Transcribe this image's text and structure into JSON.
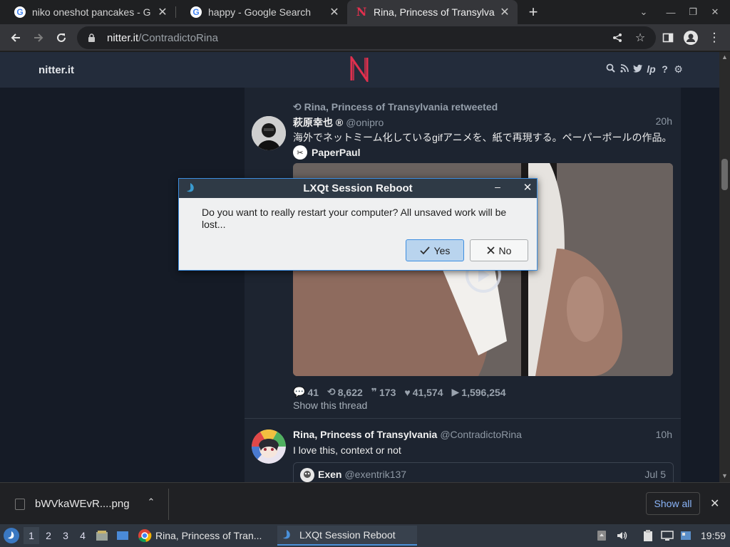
{
  "browser": {
    "tabs": [
      {
        "title": "niko oneshot pancakes - G",
        "favicon": "google-icon"
      },
      {
        "title": "happy - Google Search",
        "favicon": "google-icon"
      },
      {
        "title": "Rina, Princess of Transylva",
        "favicon": "nitter-icon",
        "active": true
      }
    ],
    "url_host": "nitter.it",
    "url_path": "/ContradictoRina"
  },
  "nitter": {
    "brand": "nitter.it",
    "tweets": [
      {
        "retweet_line": "Rina, Princess of Transylvania retweeted",
        "fullname": "萩原幸也 ®",
        "handle": "@onipro",
        "time": "20h",
        "text": "海外でネットミーム化しているgifアニメを、紙で再現する。ペーパーポールの作品。",
        "card_author": "PaperPaul",
        "stats": {
          "replies": "41",
          "retweets": "8,622",
          "quotes": "173",
          "likes": "41,574",
          "views": "1,596,254"
        },
        "thread_link": "Show this thread"
      },
      {
        "fullname": "Rina, Princess of Transylvania",
        "handle": "@ContradictoRina",
        "time": "10h",
        "text": "I love this, context or not",
        "quote_fullname": "Exen",
        "quote_handle": "@exentrik137",
        "quote_time": "Jul 5"
      }
    ]
  },
  "downloads": {
    "file_name": "bWVkaWEvR....png",
    "show_all": "Show all"
  },
  "dialog": {
    "title": "LXQt Session Reboot",
    "message": "Do you want to really restart your computer? All unsaved work will be lost...",
    "yes_label": "Yes",
    "no_label": "No"
  },
  "taskbar": {
    "desktops": [
      "1",
      "2",
      "3",
      "4"
    ],
    "active_desktop": "1",
    "apps": [
      {
        "title": "Rina, Princess of Tran...",
        "icon": "chrome-icon"
      },
      {
        "title": "LXQt Session Reboot",
        "icon": "lxqt-icon",
        "active": true
      }
    ],
    "clock": "19:59"
  },
  "colors": {
    "nitter_accent": "#e0304e",
    "page_bg": "#151b26",
    "dialog_accent": "#3d8ee0"
  }
}
